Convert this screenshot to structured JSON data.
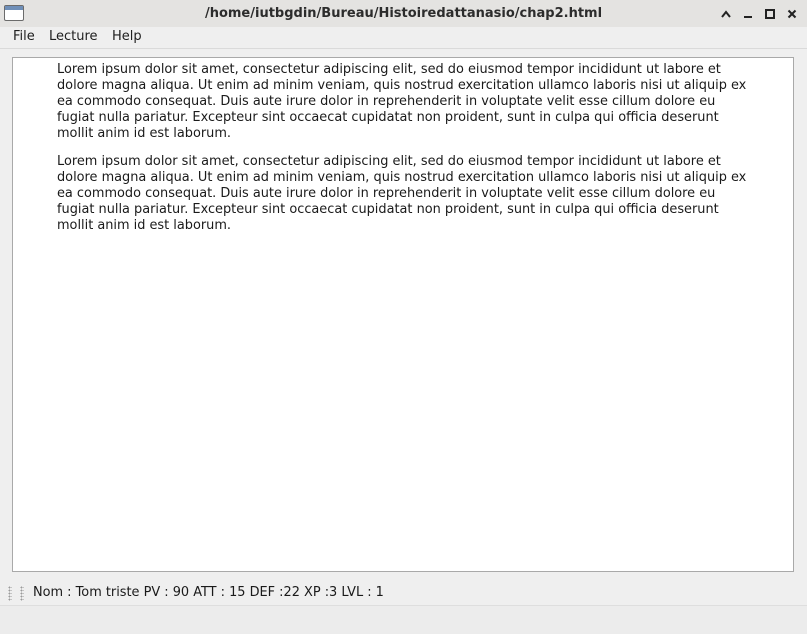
{
  "window": {
    "title": "/home/iutbgdin/Bureau/Histoiredattanasio/chap2.html"
  },
  "menu": {
    "file": "File",
    "lecture": "Lecture",
    "help": "Help"
  },
  "content": {
    "paragraphs": [
      "Lorem ipsum dolor sit amet, consectetur adipiscing elit, sed do eiusmod tempor incididunt ut labore et dolore magna aliqua. Ut enim ad minim veniam, quis nostrud exercitation ullamco laboris nisi ut aliquip ex ea commodo consequat. Duis aute irure dolor in reprehenderit in voluptate velit esse cillum dolore eu fugiat nulla pariatur. Excepteur sint occaecat cupidatat non proident, sunt in culpa qui officia deserunt mollit anim id est laborum.",
      "Lorem ipsum dolor sit amet, consectetur adipiscing elit, sed do eiusmod tempor incididunt ut labore et dolore magna aliqua. Ut enim ad minim veniam, quis nostrud exercitation ullamco laboris nisi ut aliquip ex ea commodo consequat. Duis aute irure dolor in reprehenderit in voluptate velit esse cillum dolore eu fugiat nulla pariatur. Excepteur sint occaecat cupidatat non proident, sunt in culpa qui officia deserunt mollit anim id est laborum."
    ]
  },
  "status": {
    "text": "Nom : Tom triste PV : 90 ATT : 15 DEF :22 XP :3 LVL : 1"
  },
  "icons": {
    "app": "window-app-icon",
    "minimize": "chevron-up-icon",
    "minimize_win": "minimize-icon",
    "maximize": "maximize-icon",
    "close": "close-icon"
  }
}
